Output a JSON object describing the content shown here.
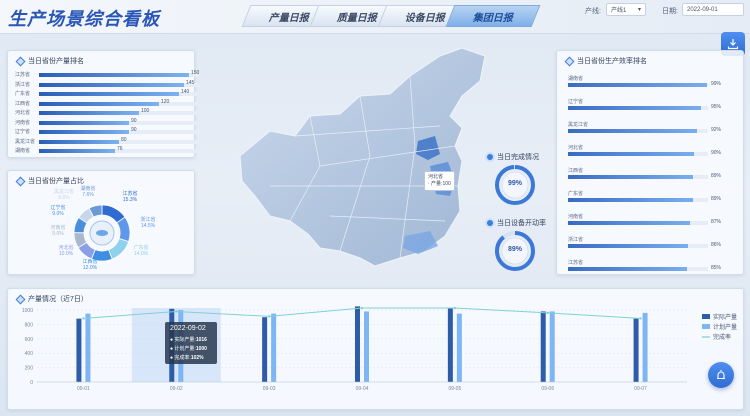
{
  "header": {
    "title": "生产场景综合看板",
    "tabs": [
      {
        "label": "产量日报",
        "active": false
      },
      {
        "label": "质量日报",
        "active": false
      },
      {
        "label": "设备日报",
        "active": false
      },
      {
        "label": "集团日报",
        "active": true
      }
    ],
    "filters": {
      "line_label": "产线:",
      "line_value": "产线1",
      "date_label": "日期:",
      "date_value": "2022-09-01"
    }
  },
  "left_top": {
    "title": "当日省份产量排名",
    "max": 150,
    "rows": [
      {
        "name": "江苏省",
        "value": 150
      },
      {
        "name": "浙江省",
        "value": 145
      },
      {
        "name": "广东省",
        "value": 140
      },
      {
        "name": "江西省",
        "value": 120
      },
      {
        "name": "河北省",
        "value": 100
      },
      {
        "name": "河南省",
        "value": 90
      },
      {
        "name": "辽宁省",
        "value": 90
      },
      {
        "name": "黑龙江省",
        "value": 80
      },
      {
        "name": "湖南省",
        "value": 76
      }
    ]
  },
  "left_mid": {
    "title": "当日省份产量占比",
    "slices": [
      {
        "name": "江苏省",
        "pct": "15.3%",
        "value": 15.3,
        "color": "#2f6bd1"
      },
      {
        "name": "浙江省",
        "pct": "14.5%",
        "value": 14.5,
        "color": "#5f97ea"
      },
      {
        "name": "广东省",
        "pct": "14.0%",
        "value": 14.0,
        "color": "#8fd0ec"
      },
      {
        "name": "江西省",
        "pct": "12.0%",
        "value": 12.0,
        "color": "#3d8fe3"
      },
      {
        "name": "河北省",
        "pct": "10.0%",
        "value": 10.0,
        "color": "#8a9fe6"
      },
      {
        "name": "河南省",
        "pct": "9.0%",
        "value": 9.0,
        "color": "#aab8cf"
      },
      {
        "name": "辽宁省",
        "pct": "9.0%",
        "value": 9.0,
        "color": "#4a8fd9"
      },
      {
        "name": "黑龙江省",
        "pct": "8.0%",
        "value": 8.0,
        "color": "#c7d6ea"
      },
      {
        "name": "湖南省",
        "pct": "7.6%",
        "value": 7.6,
        "color": "#6a9ad8"
      }
    ]
  },
  "map": {
    "tooltip_line1": "河北省",
    "tooltip_line2": "· 产量:100"
  },
  "gauges": [
    {
      "title": "当日完成情况",
      "value_text": "99%",
      "value": 99
    },
    {
      "title": "当日设备开动率",
      "value_text": "89%",
      "value": 89
    }
  ],
  "right": {
    "title": "当日省份生产效率排名",
    "rows": [
      {
        "name": "湖南省",
        "value": 99,
        "text": "99%"
      },
      {
        "name": "辽宁省",
        "value": 95,
        "text": "95%"
      },
      {
        "name": "黑龙江省",
        "value": 92,
        "text": "92%"
      },
      {
        "name": "河北省",
        "value": 90,
        "text": "90%"
      },
      {
        "name": "江西省",
        "value": 89,
        "text": "89%"
      },
      {
        "name": "广东省",
        "value": 89,
        "text": "89%"
      },
      {
        "name": "河南省",
        "value": 87,
        "text": "87%"
      },
      {
        "name": "浙江省",
        "value": 86,
        "text": "86%"
      },
      {
        "name": "江苏省",
        "value": 85,
        "text": "85%"
      }
    ]
  },
  "bottom": {
    "title": "产量情况（近7日）",
    "legend": [
      "实际产量",
      "计划产量",
      "完成率"
    ],
    "tooltip": {
      "date": "2022-09-02",
      "actual_label": "实际产量:",
      "actual_value": "1016",
      "plan_label": "计划产量:",
      "plan_value": "1000",
      "rate_label": "完成率:",
      "rate_value": "102%"
    }
  },
  "chart_data": {
    "type": "bar",
    "categories": [
      "09-01",
      "09-02",
      "09-03",
      "09-04",
      "09-05",
      "09-06",
      "09-07"
    ],
    "series": [
      {
        "name": "实际产量",
        "values": [
          880,
          1016,
          900,
          1050,
          1020,
          980,
          880
        ],
        "color": "#2d5ca8"
      },
      {
        "name": "计划产量",
        "values": [
          950,
          1000,
          950,
          980,
          950,
          980,
          960
        ],
        "color": "#7db6f2"
      },
      {
        "name": "完成率",
        "values": [
          92,
          102,
          95,
          107,
          107,
          100,
          92
        ],
        "color": "#7fd1d8"
      }
    ],
    "yticks": [
      0,
      200,
      400,
      600,
      800,
      1000
    ],
    "ylim": [
      0,
      1000
    ]
  },
  "icons": {
    "download": "download-icon",
    "alarm": "alarm-icon"
  }
}
